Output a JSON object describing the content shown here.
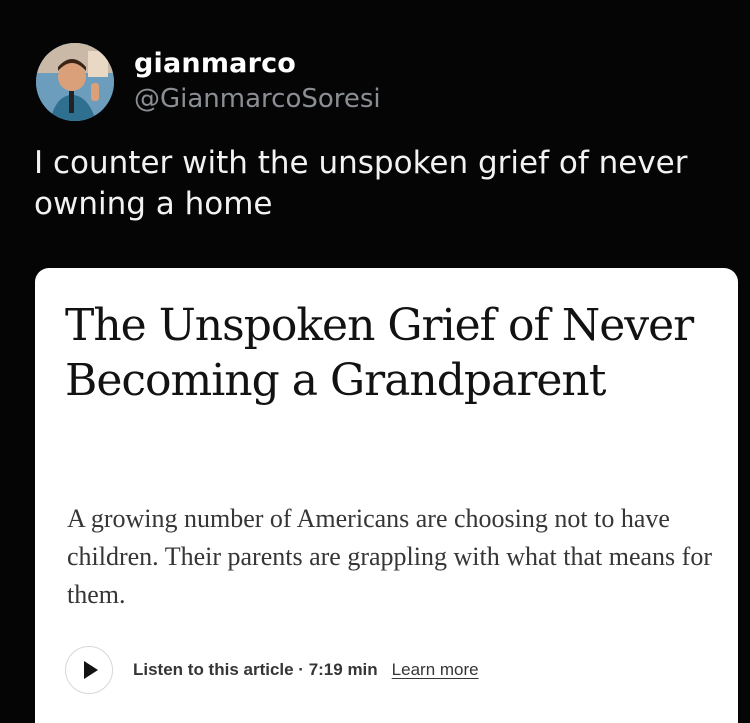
{
  "tweet": {
    "author": {
      "display_name": "gianmarco",
      "handle": "@GianmarcoSoresi",
      "avatar": "profile-photo"
    },
    "text": "I counter with the unspoken grief of never owning a home"
  },
  "article_card": {
    "headline": "The Unspoken Grief of Never Becoming a Grandparent",
    "summary": "A growing number of Americans are choosing not to have children. Their parents are grappling with what that means for them.",
    "audio": {
      "play_icon": "play-icon",
      "listen_label": "Listen to this article · 7:19 min",
      "learn_more_label": "Learn more"
    }
  },
  "colors": {
    "background": "#050505",
    "card_background": "#ffffff",
    "primary_text": "#ffffff",
    "secondary_text": "#8b8f94",
    "article_text": "#121212"
  }
}
